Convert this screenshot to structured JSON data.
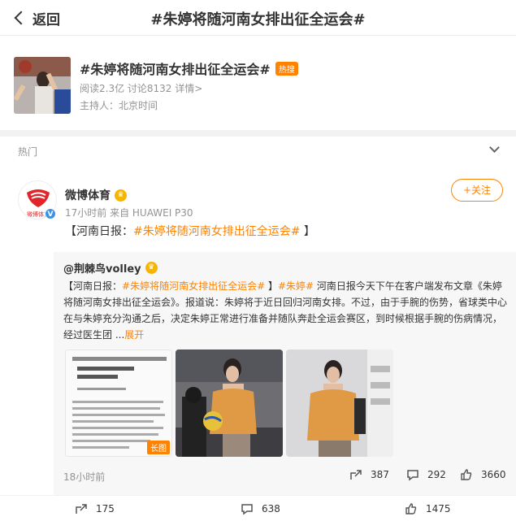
{
  "nav": {
    "back_label": "返回",
    "title": "#朱婷将随河南女排出征全运会#"
  },
  "topic": {
    "name": "#朱婷将随河南女排出征全运会#",
    "hot_badge": "热搜",
    "stats": "阅读2.3亿  讨论8132  详情>",
    "host": "主持人：北京时间"
  },
  "section": {
    "label": "热门"
  },
  "post": {
    "author": "微博体育",
    "author_badge": "♛",
    "meta": "17小时前  来自 HUAWEI P30",
    "follow_label": "+关注",
    "text_prefix": "【河南日报：",
    "text_tag": "#朱婷将随河南女排出征全运会#",
    "text_suffix": " 】",
    "avatar_text": "微博体育"
  },
  "repost": {
    "author": "@荆棘鸟volley",
    "body_prefix": "【河南日报：",
    "body_tag1": "#朱婷将随河南女排出征全运会#",
    "body_mid": " 】",
    "body_tag2": "#朱婷#",
    "body_text": " 河南日报今天下午在客户端发布文章《朱婷将随河南女排出征全运会》。报道说：朱婷将于近日回归河南女排。不过，由于手腕的伤势，省球类中心在与朱婷充分沟通之后，决定朱婷正常进行准备并随队奔赴全运会赛区，到时候根据手腕的伤病情况，经过医生团 ...",
    "more": "展开",
    "long_badge": "长图",
    "time": "18小时前",
    "reposts": "387",
    "comments": "292",
    "likes": "3660"
  },
  "bottom": {
    "reposts": "175",
    "comments": "638",
    "likes": "1475"
  }
}
